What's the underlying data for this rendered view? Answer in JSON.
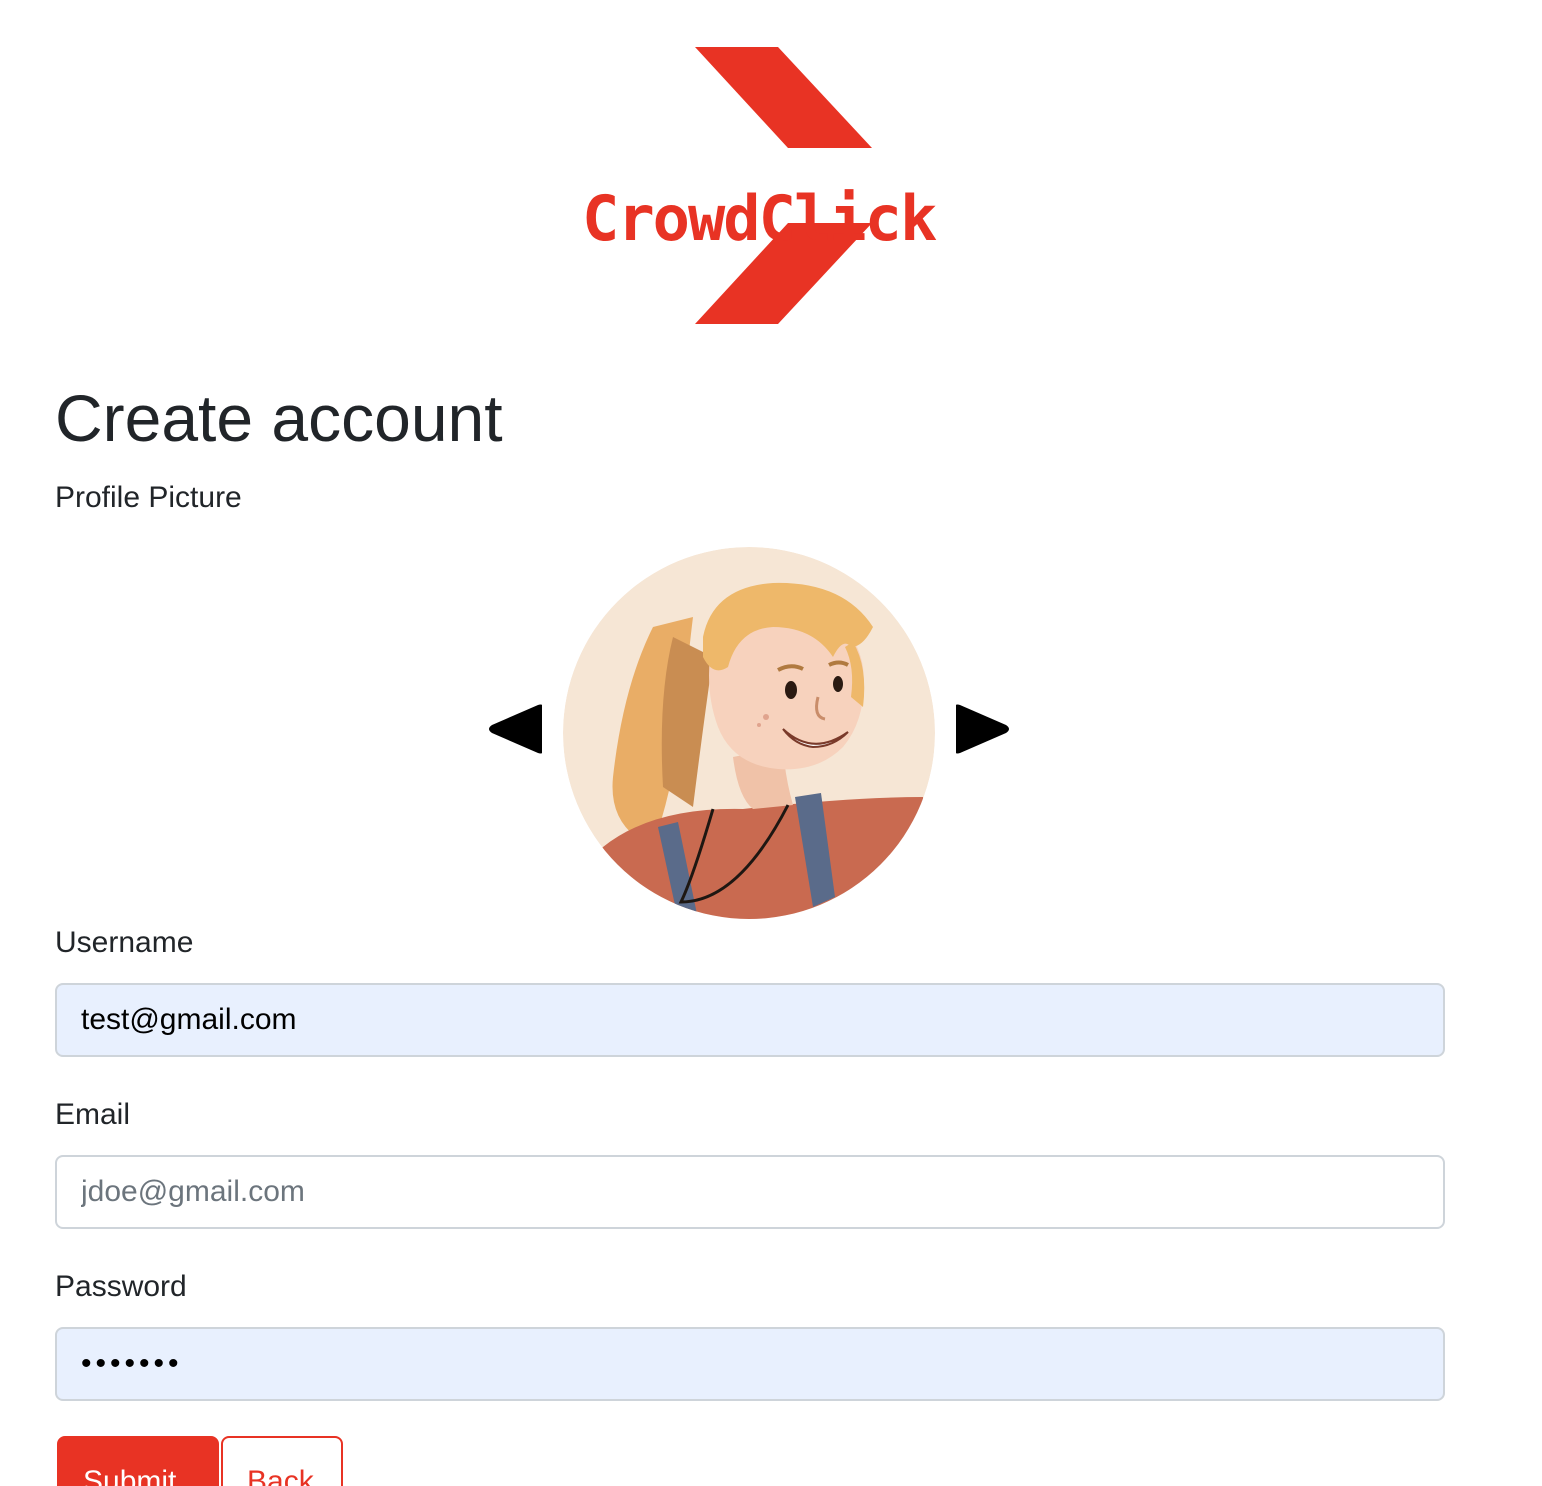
{
  "brand": {
    "name": "CrowdClick",
    "color": "#e83324"
  },
  "page": {
    "title": "Create account"
  },
  "profile_picture": {
    "label": "Profile Picture",
    "prev_icon": "triangle-left-icon",
    "next_icon": "triangle-right-icon",
    "avatar_icon": "avatar-illustration"
  },
  "form": {
    "username": {
      "label": "Username",
      "value": "test@gmail.com"
    },
    "email": {
      "label": "Email",
      "value": "",
      "placeholder": "jdoe@gmail.com"
    },
    "password": {
      "label": "Password",
      "value": "•••••••"
    },
    "submit_label": "Submit",
    "back_label": "Back"
  },
  "colors": {
    "autofill_bg": "#e8f0fe",
    "border": "#ced4da",
    "text": "#212529",
    "placeholder": "#6c757d"
  }
}
